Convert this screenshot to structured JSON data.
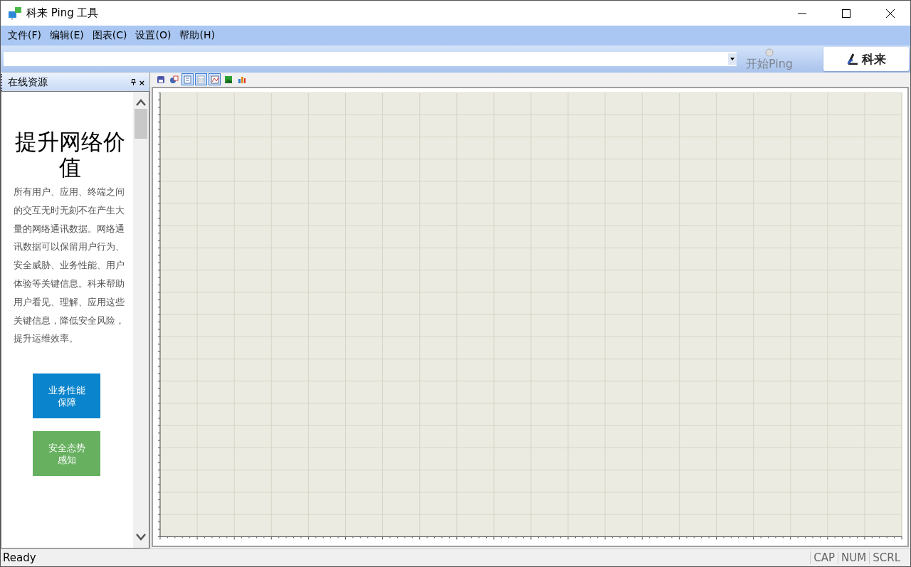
{
  "window": {
    "title": "科来 Ping 工具"
  },
  "menu": [
    "文件(F)",
    "编辑(E)",
    "图表(C)",
    "设置(O)",
    "帮助(H)"
  ],
  "address_bar": {
    "ping_button": {
      "label": "开始Ping",
      "disabled": true
    },
    "logo_text": "科来"
  },
  "side_panel": {
    "title": "在线资源",
    "close": "×",
    "heading": "提升网络价值",
    "body": "所有用户、应用、终端之间的交互无时无刻不在产生大量的网络通讯数据。网络通讯数据可以保留用户行为、安全威胁、业务性能、用户体验等关键信息。科来帮助用户看见、理解、应用这些关键信息，降低安全风险，提升运维效率。",
    "tiles": [
      {
        "label": "业务性能保障",
        "color": "#0a84cc"
      },
      {
        "label": "安全态势感知",
        "color": "#67b060"
      }
    ]
  },
  "chart_toolbar": [
    {
      "kind": "save",
      "pressed": false
    },
    {
      "kind": "copy",
      "pressed": false
    },
    {
      "kind": "page",
      "pressed": true
    },
    {
      "kind": "list",
      "pressed": true
    },
    {
      "kind": "line",
      "pressed": true
    },
    {
      "kind": "area",
      "pressed": false
    },
    {
      "kind": "bars",
      "pressed": false
    }
  ],
  "status_bar": {
    "text": "Ready",
    "indicators": [
      "CAP",
      "NUM",
      "SCRL"
    ]
  }
}
